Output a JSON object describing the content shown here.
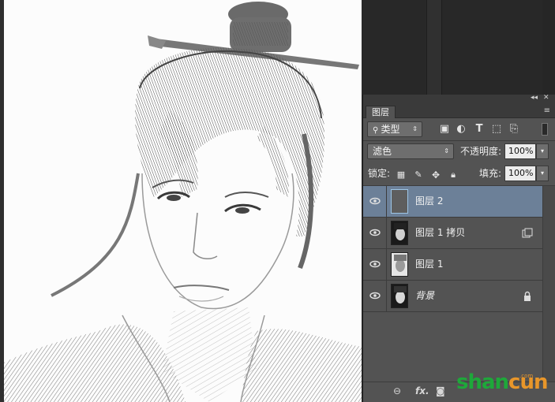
{
  "panel": {
    "tab_label": "图层",
    "collapse_label": "◂◂",
    "close_label": "✕",
    "menu_label": "≡",
    "filter": {
      "label": "类型",
      "arrow": "⇕"
    },
    "blend": {
      "mode": "滤色",
      "arrow": "⇕",
      "opacity_label": "不透明度:",
      "opacity_value": "100%"
    },
    "lock": {
      "label": "锁定:",
      "fill_label": "填充:",
      "fill_value": "100%"
    },
    "layers": [
      {
        "name": "图层 2",
        "active": true,
        "italic": false
      },
      {
        "name": "图层 1 拷贝",
        "active": false,
        "italic": false
      },
      {
        "name": "图层 1",
        "active": false,
        "italic": false
      },
      {
        "name": "背景",
        "active": false,
        "italic": true
      }
    ],
    "bottom": {
      "link": "⊖",
      "fx": "fx."
    }
  },
  "watermark": {
    "part_a": "shan",
    "part_b": "cun",
    "suffix": ".com"
  },
  "colors": {
    "panel_bg": "#535353",
    "active_layer": "#6c8098",
    "canvas_bg": "#fcfcfc"
  }
}
